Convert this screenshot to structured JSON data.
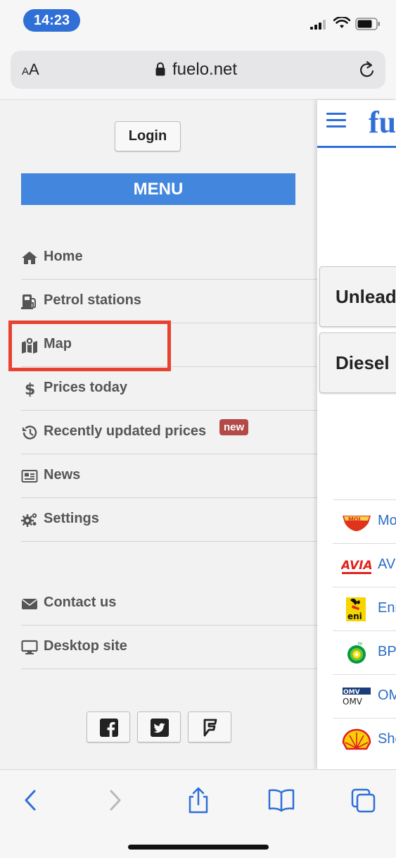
{
  "status_bar": {
    "time": "14:23"
  },
  "browser": {
    "text_size_small": "A",
    "text_size_large": "A",
    "url": "fuelo.net"
  },
  "menu": {
    "login_label": "Login",
    "header": "MENU",
    "items": [
      {
        "label": "Home",
        "icon": "home-icon"
      },
      {
        "label": "Petrol stations",
        "icon": "gas-pump-icon"
      },
      {
        "label": "Map",
        "icon": "map-marker-icon"
      },
      {
        "label": "Prices today",
        "icon": "dollar-icon"
      },
      {
        "label": "Recently updated prices",
        "icon": "history-icon",
        "badge": "new"
      },
      {
        "label": "News",
        "icon": "newspaper-icon"
      },
      {
        "label": "Settings",
        "icon": "gears-icon"
      },
      {
        "label": "Contact us",
        "icon": "envelope-icon"
      },
      {
        "label": "Desktop site",
        "icon": "desktop-icon"
      }
    ],
    "social": [
      "facebook-icon",
      "twitter-icon",
      "foursquare-icon"
    ]
  },
  "content": {
    "logo": "fu",
    "fuel_buttons": [
      "Unlead",
      "Diesel"
    ],
    "brands": [
      {
        "name": "Mo",
        "logo": "mol-logo"
      },
      {
        "name": "AV",
        "logo": "avia-logo"
      },
      {
        "name": "Eni",
        "logo": "eni-logo"
      },
      {
        "name": "BP",
        "logo": "bp-logo"
      },
      {
        "name": "OM",
        "logo": "omv-logo"
      },
      {
        "name": "She",
        "logo": "shell-logo"
      }
    ]
  },
  "colors": {
    "accent": "#4286de",
    "highlight": "#e8412f",
    "badge": "#b34a47",
    "link": "#2a6cc7"
  }
}
